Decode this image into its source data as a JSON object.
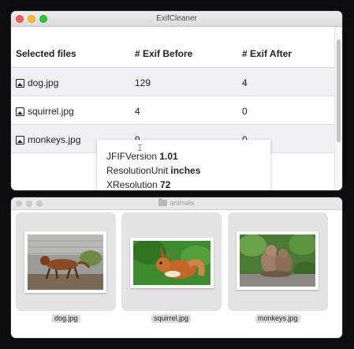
{
  "exif_window": {
    "title": "ExifCleaner",
    "columns": [
      "Selected files",
      "# Exif Before",
      "# Exif After"
    ],
    "rows": [
      {
        "file": "dog.jpg",
        "before": "129",
        "after": "4"
      },
      {
        "file": "squirrel.jpg",
        "before": "4",
        "after": "0"
      },
      {
        "file": "monkeys.jpg",
        "before": "9",
        "after": "0"
      }
    ],
    "tooltip": [
      {
        "key": "JFIFVersion",
        "value": "1.01"
      },
      {
        "key": "ResolutionUnit",
        "value": "inches"
      },
      {
        "key": "XResolution",
        "value": "72"
      }
    ]
  },
  "finder_window": {
    "title": "animals",
    "files": [
      {
        "name": "dog.jpg",
        "icon": "dog-photo"
      },
      {
        "name": "squirrel.jpg",
        "icon": "squirrel-photo"
      },
      {
        "name": "monkeys.jpg",
        "icon": "monkeys-photo"
      }
    ]
  },
  "colors": {
    "close": "#fe5f57",
    "minimize": "#febc2e",
    "zoom": "#28c840",
    "row_alt": "#f1f1f3"
  }
}
